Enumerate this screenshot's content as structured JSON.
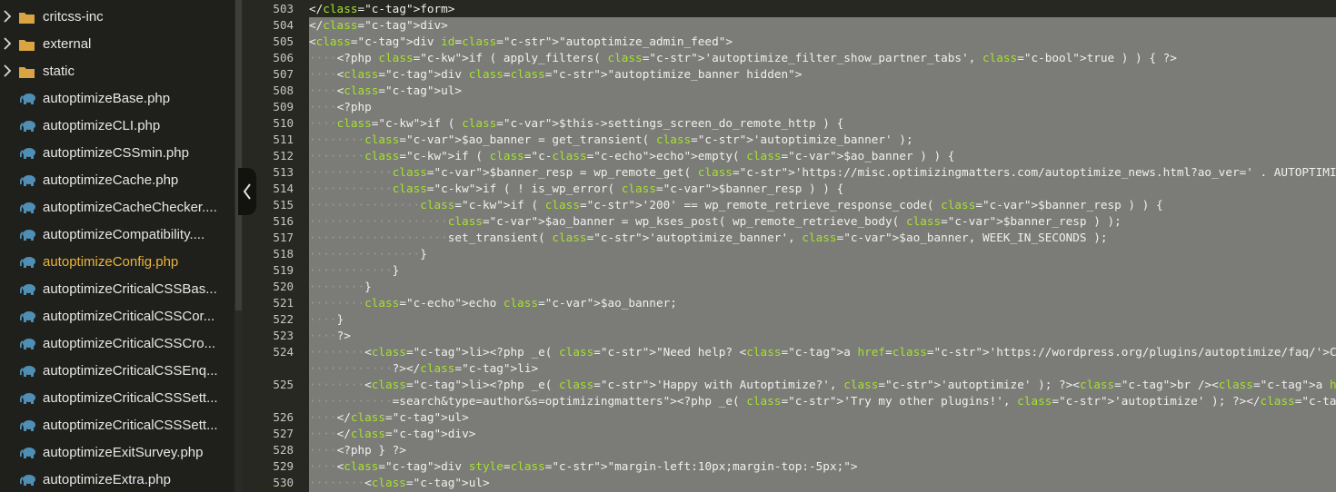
{
  "sidebar": {
    "items": [
      {
        "label": "critcss-inc",
        "type": "folder"
      },
      {
        "label": "external",
        "type": "folder"
      },
      {
        "label": "static",
        "type": "folder"
      },
      {
        "label": "autoptimizeBase.php",
        "type": "php"
      },
      {
        "label": "autoptimizeCLI.php",
        "type": "php"
      },
      {
        "label": "autoptimizeCSSmin.php",
        "type": "php"
      },
      {
        "label": "autoptimizeCache.php",
        "type": "php"
      },
      {
        "label": "autoptimizeCacheChecker....",
        "type": "php"
      },
      {
        "label": "autoptimizeCompatibility....",
        "type": "php"
      },
      {
        "label": "autoptimizeConfig.php",
        "type": "php",
        "active": true
      },
      {
        "label": "autoptimizeCriticalCSSBas...",
        "type": "php"
      },
      {
        "label": "autoptimizeCriticalCSSCor...",
        "type": "php"
      },
      {
        "label": "autoptimizeCriticalCSSCro...",
        "type": "php"
      },
      {
        "label": "autoptimizeCriticalCSSEnq...",
        "type": "php"
      },
      {
        "label": "autoptimizeCriticalCSSSett...",
        "type": "php"
      },
      {
        "label": "autoptimizeCriticalCSSSett...",
        "type": "php"
      },
      {
        "label": "autoptimizeExitSurvey.php",
        "type": "php"
      },
      {
        "label": "autoptimizeExtra.php",
        "type": "php"
      }
    ]
  },
  "colors": {
    "active_file": "#e8b338",
    "selection": "#7b7b78",
    "php_icon": "#4f8fb5",
    "folder_icon": "#d9a441"
  },
  "editor": {
    "line_numbers": [
      "503",
      "504",
      "505",
      "506",
      "507",
      "508",
      "509",
      "510",
      "511",
      "512",
      "513",
      "514",
      "515",
      "516",
      "517",
      "518",
      "519",
      "520",
      "521",
      "522",
      "523",
      "524",
      "",
      "525",
      "",
      "526",
      "527",
      "528",
      "529",
      "530"
    ],
    "lines": [
      "</form>",
      "</div>",
      "<div id=\"autoptimize_admin_feed\">",
      "    <?php if ( apply_filters( 'autoptimize_filter_show_partner_tabs', true ) ) { ?>",
      "    <div class=\"autoptimize_banner hidden\">",
      "    <ul>",
      "    <?php",
      "    if ( $this->settings_screen_do_remote_http ) {",
      "        $ao_banner = get_transient( 'autoptimize_banner' );",
      "        if ( empty( $ao_banner ) ) {",
      "            $banner_resp = wp_remote_get( 'https://misc.optimizingmatters.com/autoptimize_news.html?ao_ver=' . AUTOPTIMIZE_PLUGIN_VERSION",
      "            if ( ! is_wp_error( $banner_resp ) ) {",
      "                if ( '200' == wp_remote_retrieve_response_code( $banner_resp ) ) {",
      "                    $ao_banner = wp_kses_post( wp_remote_retrieve_body( $banner_resp ) );",
      "                    set_transient( 'autoptimize_banner', $ao_banner, WEEK_IN_SECONDS );",
      "                }",
      "            }",
      "        }",
      "        echo $ao_banner;",
      "    }",
      "    ?>",
      "        <li><?php _e( \"Need help? <a href='https://wordpress.org/plugins/autoptimize/faq/'>Check out the FAQ here</a>.\", 'autoptimize' );",
      "            ?></li>",
      "        <li><?php _e( 'Happy with Autoptimize?', 'autoptimize' ); ?><br /><a href=\"<?php echo network_admin_url(); ?>plugin-install.php?t",
      "            =search&type=author&s=optimizingmatters\"><?php _e( 'Try my other plugins!', 'autoptimize' ); ?></a></li>",
      "    </ul>",
      "    </div>",
      "    <?php } ?>",
      "    <div style=\"margin-left:10px;margin-top:-5px;\">",
      "        <ul>"
    ]
  }
}
